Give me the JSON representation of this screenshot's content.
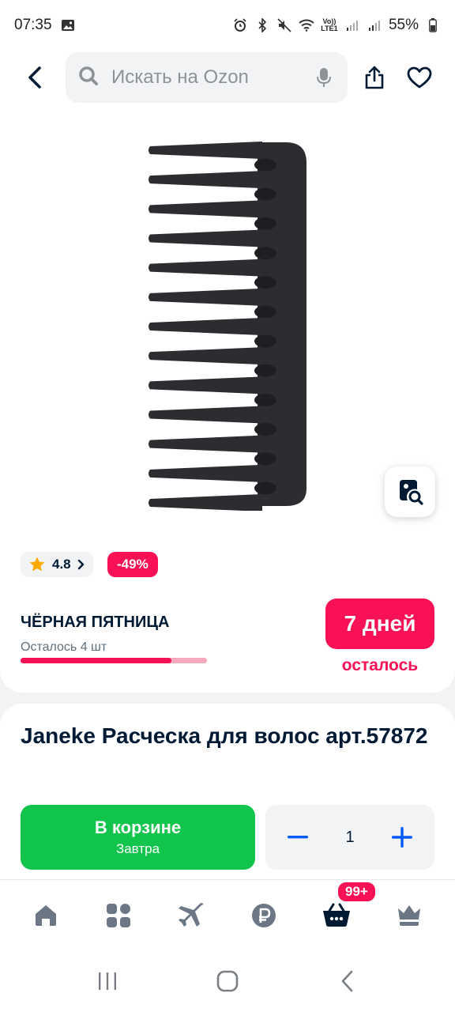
{
  "status_bar": {
    "time": "07:35",
    "battery": "55%",
    "network_line1": "Vo))",
    "network_line2": "LTE1"
  },
  "search": {
    "placeholder": "Искать на Ozon"
  },
  "product": {
    "rating": "4.8",
    "discount": "-49%",
    "title": "Janeke Расческа для волос арт.57872"
  },
  "promo": {
    "title": "ЧЁРНАЯ ПЯТНИЦА",
    "stock_text": "Осталось 4 шт",
    "stock_progress": 0.81,
    "timer": "7 дней",
    "timer_sub": "осталось"
  },
  "cart": {
    "button_label": "В корзине",
    "delivery": "Завтра",
    "quantity": "1"
  },
  "tabbar": {
    "items": [
      "home-icon",
      "catalog-icon",
      "travel-icon",
      "finance-icon",
      "cart-icon",
      "premium-icon"
    ],
    "cart_badge": "99+"
  },
  "colors": {
    "accent": "#f91155",
    "green": "#10c44c",
    "blue": "#005bff"
  }
}
